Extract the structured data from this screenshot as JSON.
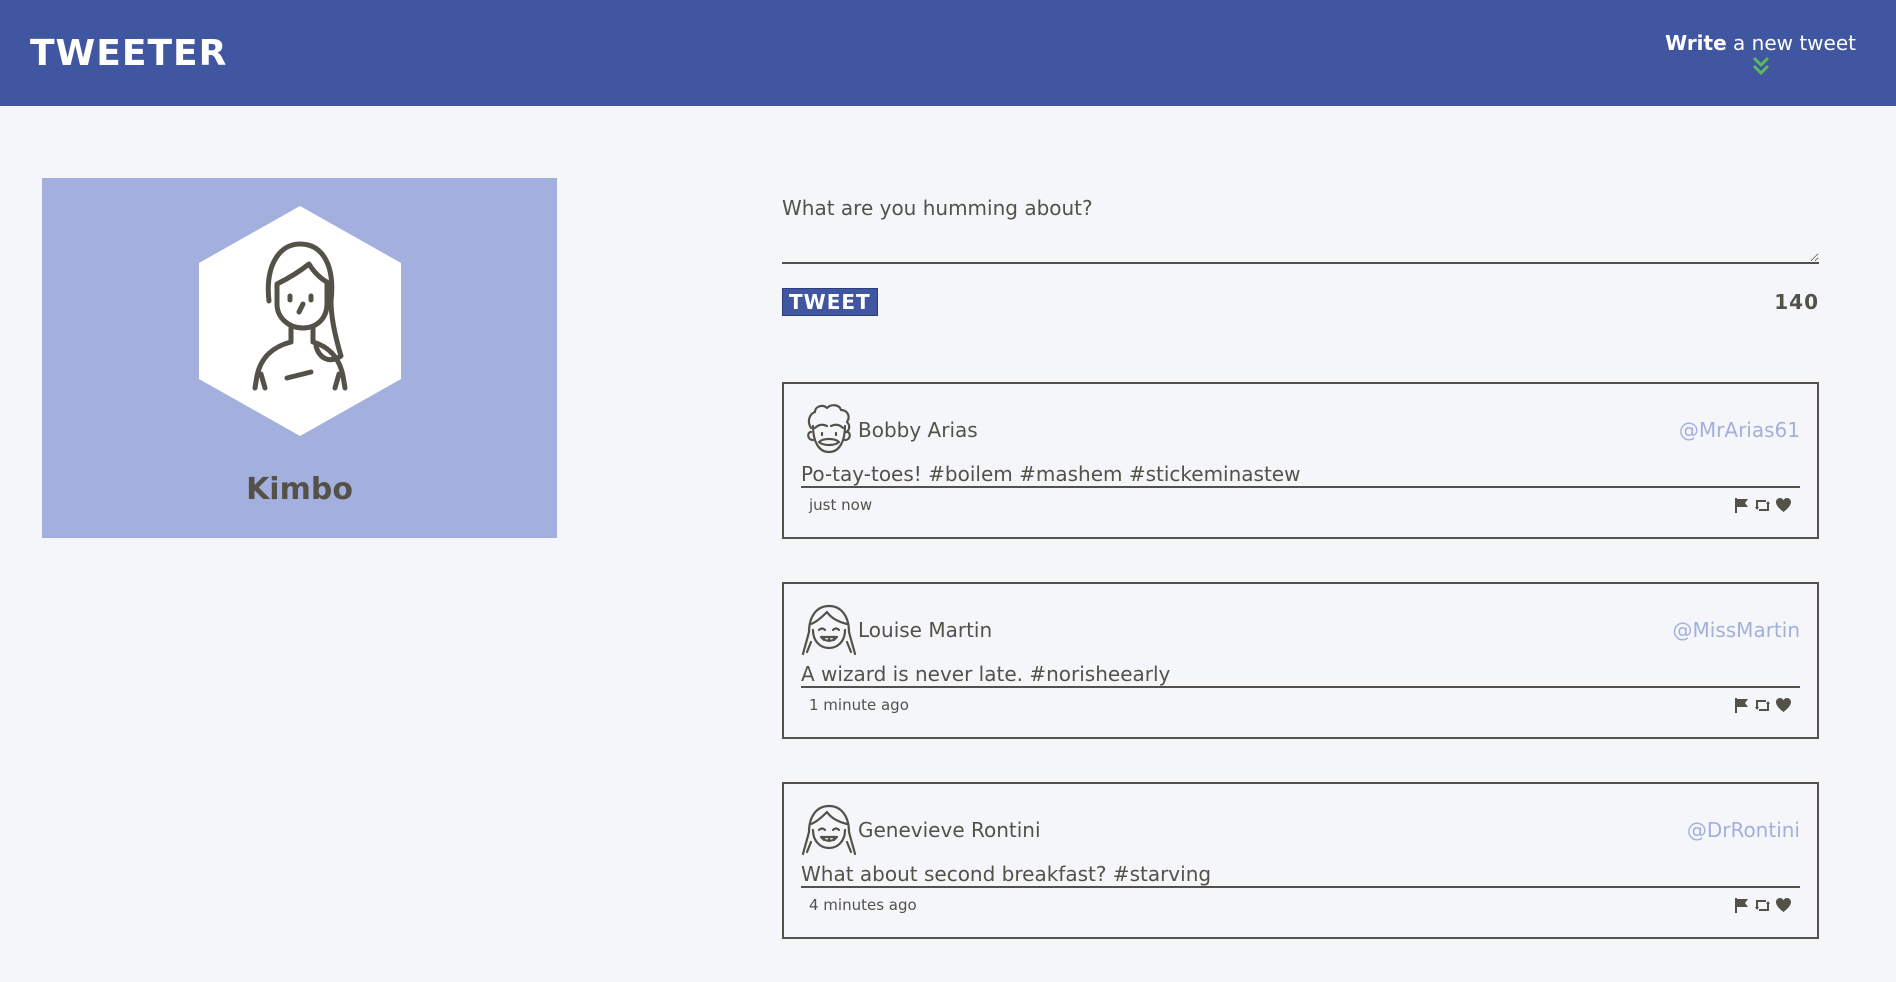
{
  "nav": {
    "brand": "TWEETER",
    "compose_strong": "Write",
    "compose_rest": " a new tweet",
    "compose_icon": "double-chevron-down-icon"
  },
  "profile": {
    "name": "Kimbo",
    "avatar_icon": "woman-avatar-icon"
  },
  "composer": {
    "placeholder": "What are you humming about?",
    "button_label": "TWEET",
    "counter": "140"
  },
  "tweets": [
    {
      "name": "Bobby Arias",
      "handle": "@MrArias61",
      "content": "Po-tay-toes! #boilem #mashem #stickeminastew",
      "time": "just now",
      "avatar_icon": "curly-man-avatar-icon"
    },
    {
      "name": "Louise Martin",
      "handle": "@MissMartin",
      "content": "A wizard is never late. #norisheearly",
      "time": "1 minute ago",
      "avatar_icon": "girl-avatar-icon"
    },
    {
      "name": "Genevieve Rontini",
      "handle": "@DrRontini",
      "content": "What about second breakfast? #starving",
      "time": "4 minutes ago",
      "avatar_icon": "girl-avatar-icon"
    }
  ],
  "colors": {
    "nav": "#4056a1",
    "profile_bg": "#a3b0de",
    "text": "#545149",
    "handle": "#a3b0de",
    "chevron": "#5cb85c"
  }
}
